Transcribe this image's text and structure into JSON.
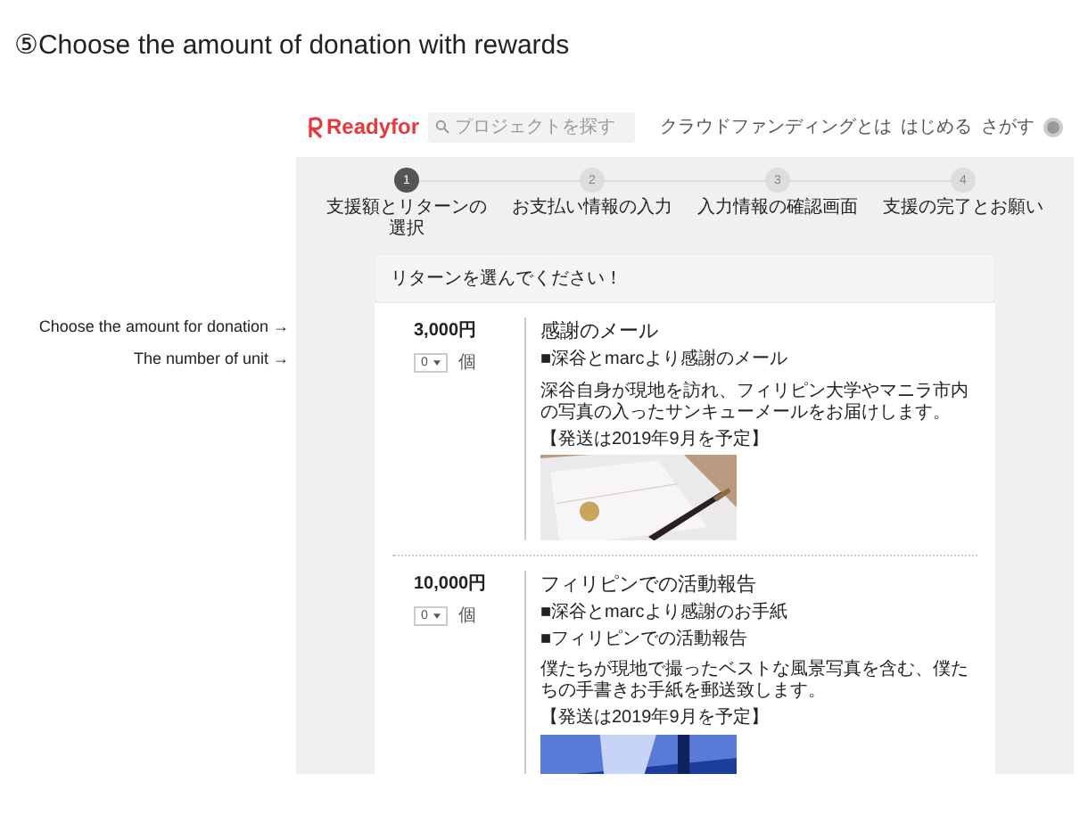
{
  "heading": "⑤Choose the amount of donation with rewards",
  "annotations": [
    {
      "text": "Choose the amount for donation →"
    },
    {
      "text": "The number of unit →"
    }
  ],
  "site": {
    "logo": "Readyfor",
    "search": {
      "placeholder": "プロジェクトを探す"
    },
    "nav": [
      "クラウドファンディングとは",
      "はじめる",
      "さがす"
    ]
  },
  "steps": [
    {
      "number": "1",
      "label": "支援額とリターンの選択",
      "selected": true
    },
    {
      "number": "2",
      "label": "お支払い情報の入力",
      "selected": false
    },
    {
      "number": "3",
      "label": "入力情報の確認画面",
      "selected": false
    },
    {
      "number": "4",
      "label": "支援の完了とお願い",
      "selected": false
    }
  ],
  "rewards_panel": {
    "title": "リターンを選んでください！",
    "rewards": [
      {
        "price": "3,000円",
        "quantity": "0",
        "unit": "個",
        "title": "感謝のメール",
        "items": [
          "■深谷とmarcより感謝のメール"
        ],
        "description": "深谷自身が現地を訪れ、フィリピン大学やマニラ市内の写真の入ったサンキューメールをお届けします。",
        "shipping": "【発送は2019年9月を予定】",
        "image": {
          "kind": "picture"
        }
      },
      {
        "price": "10,000円",
        "quantity": "0",
        "unit": "個",
        "title": "フィリピンでの活動報告",
        "items": [
          "■深谷とmarcより感謝のお手紙",
          "■フィリピンでの活動報告"
        ],
        "description": "僕たちが現地で撮ったベストな風景写真を含む、僕たちの手書きお手紙を郵送致します。",
        "shipping": "【発送は2019年9月を予定】",
        "image": {
          "kind": "picture"
        }
      }
    ]
  }
}
